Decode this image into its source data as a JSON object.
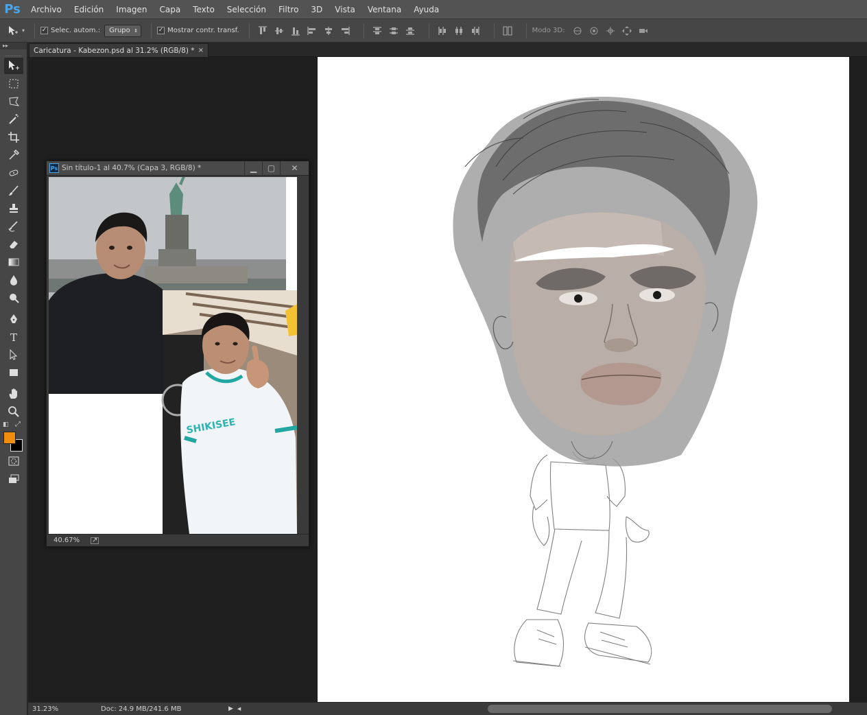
{
  "app": {
    "logo": "Ps"
  },
  "menu": [
    "Archivo",
    "Edición",
    "Imagen",
    "Capa",
    "Texto",
    "Selección",
    "Filtro",
    "3D",
    "Vista",
    "Ventana",
    "Ayuda"
  ],
  "options": {
    "auto_select_label": "Selec. autom.:",
    "auto_select_checked": true,
    "auto_select_value": "Grupo",
    "show_transform_label": "Mostrar contr. transf.",
    "show_transform_checked": true,
    "mode_3d_label": "Modo 3D:"
  },
  "document_tab": {
    "title": "Caricatura - Kabezon.psd al 31.2% (RGB/8) *",
    "close": "×"
  },
  "floating_window": {
    "badge": "Ps",
    "title": "Sin título-1 al 40.7% (Capa 3, RGB/8) *",
    "zoom": "40.67%"
  },
  "status": {
    "zoom": "31.23%",
    "doc_info": "Doc: 24.9 MB/241.6 MB"
  },
  "colors": {
    "foreground": "#f08c0e",
    "background": "#000000",
    "accent": "#4aa6e8"
  },
  "tools": [
    "move-tool",
    "marquee-tool",
    "lasso-tool",
    "magic-wand-tool",
    "crop-tool",
    "eyedropper-tool",
    "healing-brush-tool",
    "brush-tool",
    "clone-stamp-tool",
    "history-brush-tool",
    "eraser-tool",
    "gradient-tool",
    "blur-tool",
    "dodge-tool",
    "pen-tool",
    "type-tool",
    "path-selection-tool",
    "rectangle-tool",
    "hand-tool",
    "zoom-tool"
  ]
}
